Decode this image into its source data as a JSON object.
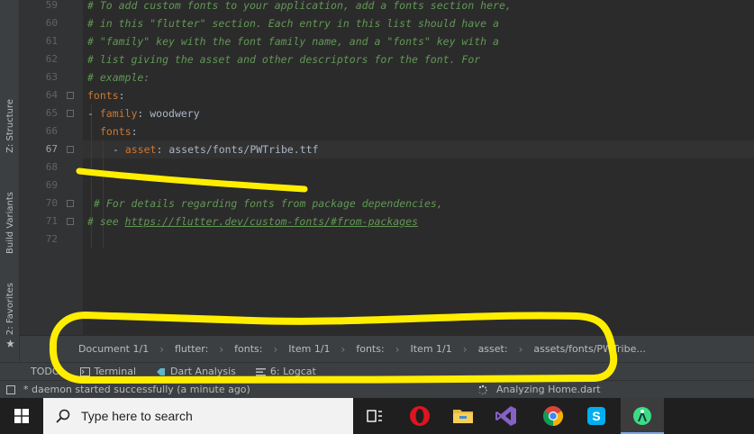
{
  "editor": {
    "line_numbers": [
      "59",
      "60",
      "61",
      "62",
      "63",
      "64",
      "65",
      "66",
      "67",
      "68",
      "69",
      "70",
      "71",
      "72"
    ],
    "current_line": "67",
    "lines": {
      "l59": "# To add custom fonts to your application, add a fonts section here,",
      "l60": "# in this \"flutter\" section. Each entry in this list should have a",
      "l61": "# \"family\" key with the font family name, and a \"fonts\" key with a",
      "l62": "# list giving the asset and other descriptors for the font. For",
      "l63": "# example:",
      "l64_key": "fonts",
      "l64_colon": ":",
      "l65_dash": "- ",
      "l65_key": "family",
      "l65_val": ": woodwery",
      "l66_key": "fonts",
      "l66_colon": ":",
      "l67_dash": "- ",
      "l67_key": "asset",
      "l67_val": ": assets/fonts/PWTribe.ttf",
      "l70": "# For details regarding fonts from package dependencies,",
      "l71_prefix": "# see ",
      "l71_link": "https://flutter.dev/custom-fonts/#from-packages"
    }
  },
  "left_tabs": {
    "structure": "Z: Structure",
    "build_variants": "Build Variants",
    "favorites": "2: Favorites"
  },
  "breadcrumb": [
    "Document 1/1",
    "flutter:",
    "fonts:",
    "Item 1/1",
    "fonts:",
    "Item 1/1",
    "asset:",
    "assets/fonts/PWTribe..."
  ],
  "tool_windows": {
    "todo": "TODO",
    "terminal": "Terminal",
    "dart_analysis": "Dart Analysis",
    "logcat": "6: Logcat"
  },
  "status": {
    "message": "* daemon started successfully (a minute ago)",
    "progress": "Analyzing Home.dart"
  },
  "taskbar": {
    "search_placeholder": "Type here to search"
  },
  "icons": {
    "start": "windows-start-icon",
    "search": "search-icon",
    "task_view": "task-view-icon",
    "opera": "opera-icon",
    "explorer": "folder-icon",
    "vs": "visual-studio-icon",
    "chrome": "chrome-icon",
    "skype": "skype-icon",
    "android_studio": "android-studio-icon"
  },
  "colors": {
    "annotation": "#ffee00",
    "comment": "#629755",
    "keyword": "#cc7832"
  }
}
